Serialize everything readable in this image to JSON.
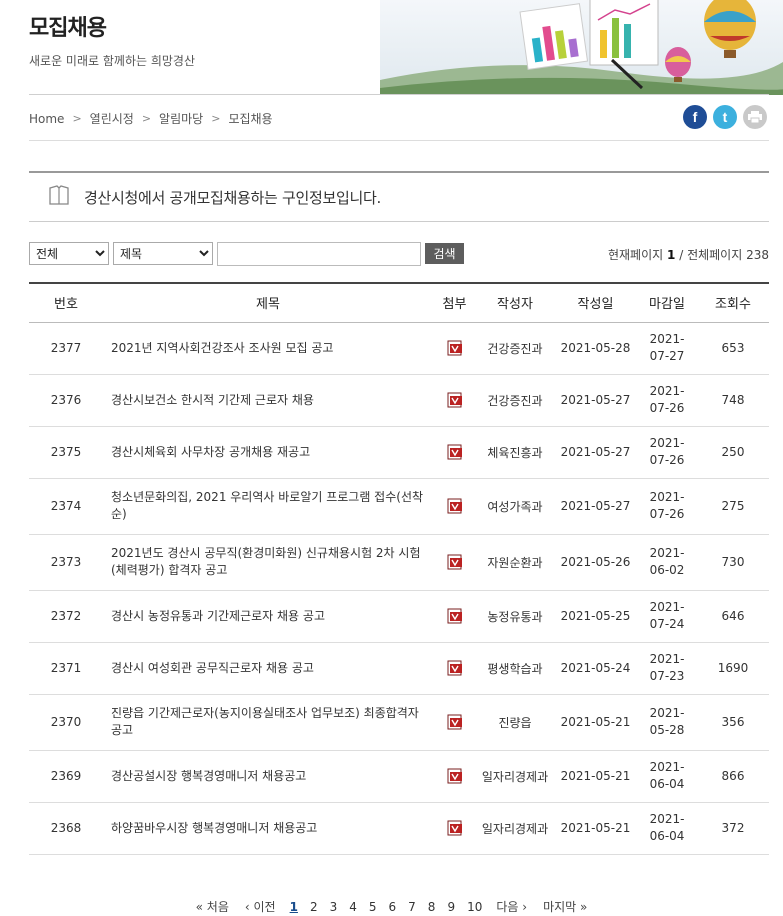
{
  "header": {
    "title": "모집채용",
    "subtitle": "새로운 미래로 함께하는 희망경산"
  },
  "breadcrumb": [
    "Home",
    "열린시정",
    "알림마당",
    "모집채용"
  ],
  "intro": "경산시청에서 공개모집채용하는 구인정보입니다.",
  "search": {
    "category_selected": "전체",
    "field_selected": "제목",
    "keyword": "",
    "button_label": "검색"
  },
  "page_info": {
    "current_label": "현재페이지",
    "current": "1",
    "sep": "/",
    "total_label": "전체페이지",
    "total": "238"
  },
  "columns": [
    "번호",
    "제목",
    "첨부",
    "작성자",
    "작성일",
    "마감일",
    "조회수"
  ],
  "rows": [
    {
      "no": "2377",
      "title": "2021년 지역사회건강조사 조사원 모집 공고",
      "author": "건강증진과",
      "date": "2021-05-28",
      "deadline": "2021-07-27",
      "views": "653"
    },
    {
      "no": "2376",
      "title": "경산시보건소 한시적 기간제 근로자 채용",
      "author": "건강증진과",
      "date": "2021-05-27",
      "deadline": "2021-07-26",
      "views": "748"
    },
    {
      "no": "2375",
      "title": "경산시체육회 사무차장 공개채용 재공고",
      "author": "체육진흥과",
      "date": "2021-05-27",
      "deadline": "2021-07-26",
      "views": "250"
    },
    {
      "no": "2374",
      "title": "청소년문화의집, 2021 우리역사 바로알기 프로그램 접수(선착순)",
      "author": "여성가족과",
      "date": "2021-05-27",
      "deadline": "2021-07-26",
      "views": "275"
    },
    {
      "no": "2373",
      "title": "2021년도 경산시 공무직(환경미화원) 신규채용시험 2차 시험(체력평가) 합격자 공고",
      "author": "자원순환과",
      "date": "2021-05-26",
      "deadline": "2021-06-02",
      "views": "730"
    },
    {
      "no": "2372",
      "title": "경산시 농정유통과 기간제근로자 채용 공고",
      "author": "농정유통과",
      "date": "2021-05-25",
      "deadline": "2021-07-24",
      "views": "646"
    },
    {
      "no": "2371",
      "title": "경산시 여성회관 공무직근로자 채용 공고",
      "author": "평생학습과",
      "date": "2021-05-24",
      "deadline": "2021-07-23",
      "views": "1690"
    },
    {
      "no": "2370",
      "title": "진량읍 기간제근로자(농지이용실태조사 업무보조) 최종합격자 공고",
      "author": "진량읍",
      "date": "2021-05-21",
      "deadline": "2021-05-28",
      "views": "356"
    },
    {
      "no": "2369",
      "title": "경산공설시장 행복경영매니저 채용공고",
      "author": "일자리경제과",
      "date": "2021-05-21",
      "deadline": "2021-06-04",
      "views": "866"
    },
    {
      "no": "2368",
      "title": "하양꿈바우시장 행복경영매니저 채용공고",
      "author": "일자리경제과",
      "date": "2021-05-21",
      "deadline": "2021-06-04",
      "views": "372"
    }
  ],
  "pagination": {
    "first": "« 처음",
    "prev": "‹ 이전",
    "pages": [
      "1",
      "2",
      "3",
      "4",
      "5",
      "6",
      "7",
      "8",
      "9",
      "10"
    ],
    "current": "1",
    "next": "다음 ›",
    "last": "마지막 »"
  },
  "icons": {
    "facebook": "facebook-icon",
    "twitter": "twitter-icon",
    "print": "print-icon",
    "attachment": "hwp-file-icon",
    "notice": "document-icon"
  },
  "colors": {
    "facebook": "#1f4d96",
    "twitter": "#3cb0de",
    "print": "#c9c9c9",
    "search_button": "#5d5d5d",
    "current_page": "#1a4d8c"
  }
}
